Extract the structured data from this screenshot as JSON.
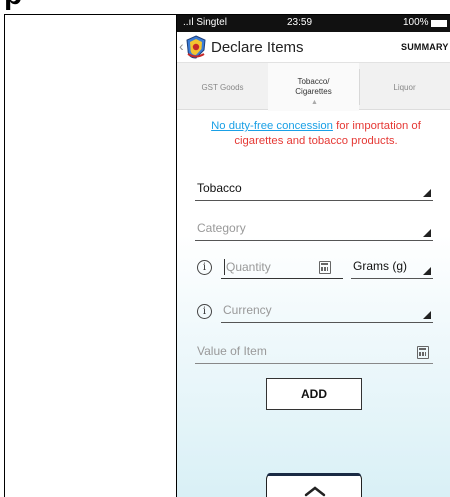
{
  "status_bar": {
    "carrier": "..ıl Singtel",
    "time": "23:59",
    "battery": "100%"
  },
  "app_bar": {
    "title": "Declare Items",
    "summary_label": "SUMMARY"
  },
  "tabs": [
    {
      "label": "GST Goods",
      "active": false
    },
    {
      "label": "Tobacco/ Cigarettes",
      "active": true
    },
    {
      "label": "Liquor",
      "active": false
    }
  ],
  "notice": {
    "link_text": "No duty-free concession",
    "text": " for importation of cigarettes and tobacco products."
  },
  "form": {
    "type_value": "Tobacco",
    "category_placeholder": "Category",
    "quantity_placeholder": "Quantity",
    "unit_value": "Grams (g)",
    "currency_placeholder": "Currency",
    "value_placeholder": "Value of Item",
    "add_label": "ADD"
  },
  "colors": {
    "notice_red": "#e53935",
    "link_blue": "#1aa0e6"
  }
}
